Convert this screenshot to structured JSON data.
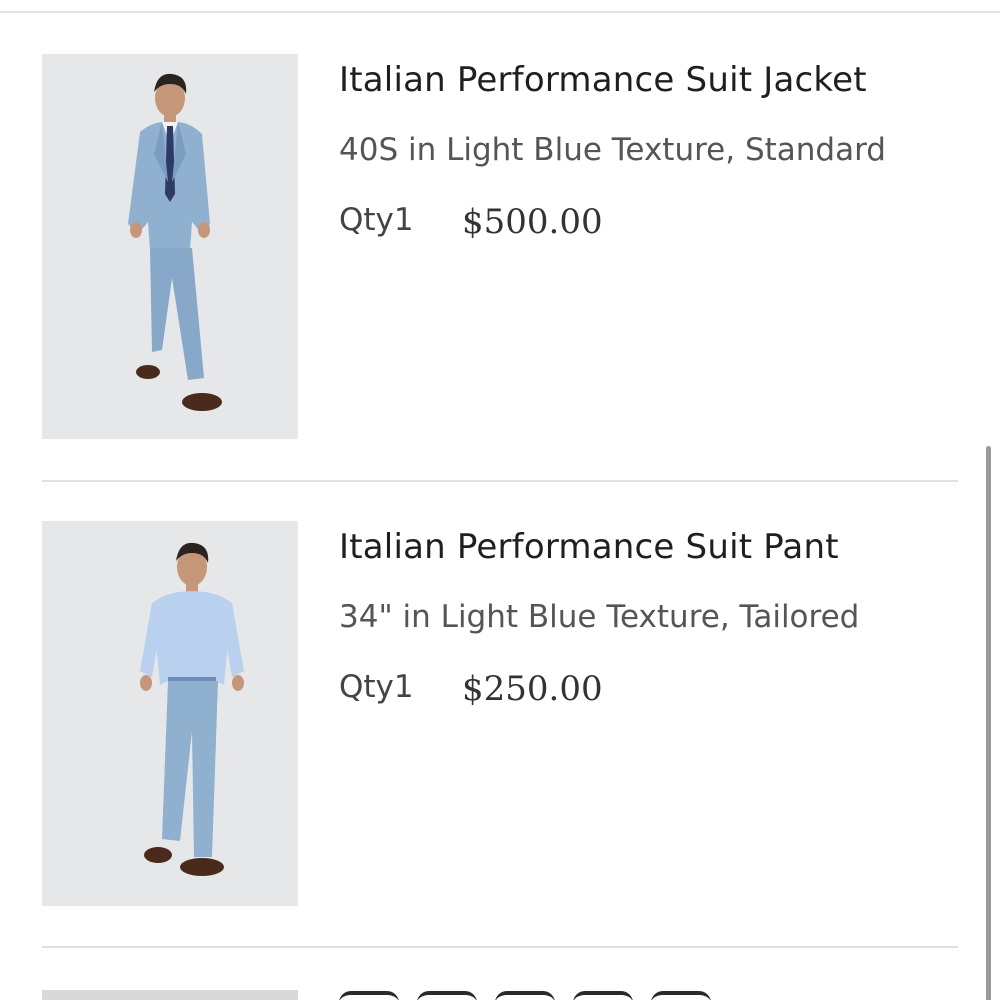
{
  "cart": {
    "items": [
      {
        "name": "Italian Performance Suit Jacket",
        "variant": "40S in Light Blue Texture, Standard",
        "qty_label": "Qty",
        "qty": "1",
        "price": "$500.00",
        "image_icon": "suit-jacket-photo"
      },
      {
        "name": "Italian Performance Suit Pant",
        "variant": "34\" in Light Blue Texture, Tailored",
        "qty_label": "Qty",
        "qty": "1",
        "price": "$250.00",
        "image_icon": "suit-pant-photo"
      }
    ]
  },
  "colors": {
    "suit_blue": "#8fb0cf",
    "shirt_blue": "#b9d0ee",
    "photo_bg": "#e6e7e9",
    "divider": "#e0e0e0"
  }
}
